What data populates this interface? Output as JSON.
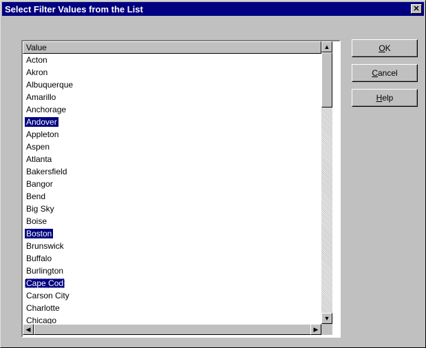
{
  "window": {
    "title": "Select Filter Values from the List",
    "close_glyph": "✕"
  },
  "listbox": {
    "column_header": "Value",
    "items": [
      {
        "label": "Acton",
        "selected": false
      },
      {
        "label": "Akron",
        "selected": false
      },
      {
        "label": "Albuquerque",
        "selected": false
      },
      {
        "label": "Amarillo",
        "selected": false
      },
      {
        "label": "Anchorage",
        "selected": false
      },
      {
        "label": "Andover",
        "selected": true
      },
      {
        "label": "Appleton",
        "selected": false
      },
      {
        "label": "Aspen",
        "selected": false
      },
      {
        "label": "Atlanta",
        "selected": false
      },
      {
        "label": "Bakersfield",
        "selected": false
      },
      {
        "label": "Bangor",
        "selected": false
      },
      {
        "label": "Bend",
        "selected": false
      },
      {
        "label": "Big Sky",
        "selected": false
      },
      {
        "label": "Boise",
        "selected": false
      },
      {
        "label": "Boston",
        "selected": true
      },
      {
        "label": "Brunswick",
        "selected": false
      },
      {
        "label": "Buffalo",
        "selected": false
      },
      {
        "label": "Burlington",
        "selected": false
      },
      {
        "label": "Cape Cod",
        "selected": true,
        "focused": true
      },
      {
        "label": "Carson City",
        "selected": false
      },
      {
        "label": "Charlotte",
        "selected": false
      },
      {
        "label": "Chicago",
        "selected": false
      }
    ],
    "scroll_up_glyph": "▲",
    "scroll_down_glyph": "▼",
    "scroll_left_glyph": "◀",
    "scroll_right_glyph": "▶"
  },
  "buttons": {
    "ok": {
      "mnemonic": "O",
      "rest": "K"
    },
    "cancel": {
      "mnemonic": "C",
      "rest": "ancel"
    },
    "help": {
      "mnemonic": "H",
      "rest": "elp"
    }
  },
  "colors": {
    "face": "#c0c0c0",
    "title_bar": "#000080",
    "selection": "#000080"
  }
}
